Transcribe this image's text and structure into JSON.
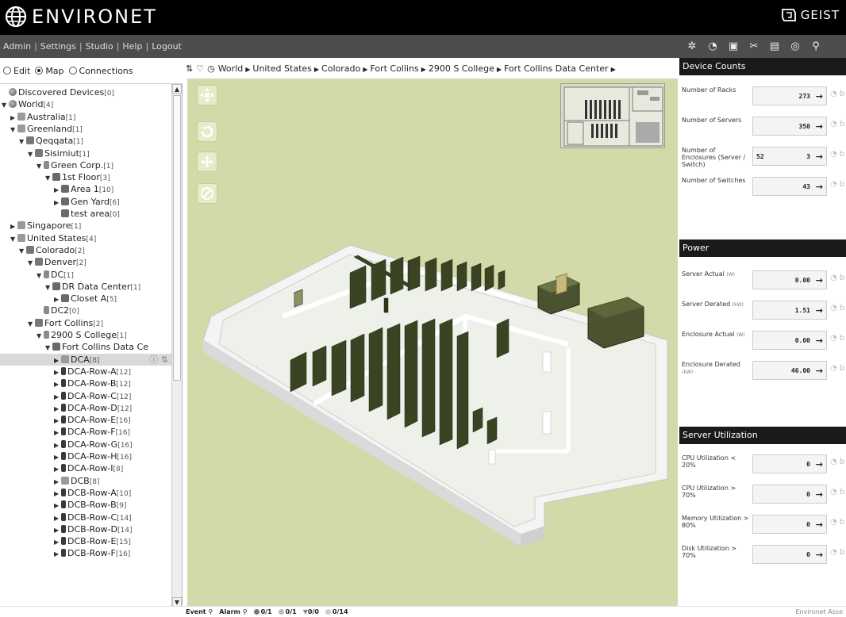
{
  "app": {
    "logo_text": "ENVIRONET",
    "brand": "GEIST"
  },
  "menu": {
    "items": [
      "Admin",
      "Settings",
      "Studio",
      "Help",
      "Logout"
    ]
  },
  "toolbar": {
    "icons": [
      "gear-icon",
      "dashboard-icon",
      "clipboard-icon",
      "scissors-icon",
      "server-icon",
      "globe-search-icon",
      "search-icon"
    ]
  },
  "view_modes": {
    "edit": "Edit",
    "map": "Map",
    "connections": "Connections",
    "selected": "Map"
  },
  "breadcrumb": [
    "World",
    "United States",
    "Colorado",
    "Fort Collins",
    "2900 S College",
    "Fort Collins Data Center"
  ],
  "tree": [
    {
      "label": "Discovered Devices",
      "count": "[0]",
      "icon": "globe",
      "expanded": null,
      "depth": 0
    },
    {
      "label": "World",
      "count": "[4]",
      "icon": "globe",
      "expanded": true,
      "depth": 0
    },
    {
      "label": "Australia",
      "count": "[1]",
      "icon": "flag",
      "expanded": false,
      "depth": 1
    },
    {
      "label": "Greenland",
      "count": "[1]",
      "icon": "flag",
      "expanded": true,
      "depth": 1
    },
    {
      "label": "Qeqqata",
      "count": "[1]",
      "icon": "city",
      "expanded": true,
      "depth": 2
    },
    {
      "label": "Sisimiut",
      "count": "[1]",
      "icon": "city",
      "expanded": true,
      "depth": 3
    },
    {
      "label": "Green Corp.",
      "count": "[1]",
      "icon": "bldg",
      "expanded": true,
      "depth": 4
    },
    {
      "label": "1st Floor",
      "count": "[3]",
      "icon": "floor",
      "expanded": true,
      "depth": 5
    },
    {
      "label": "Area 1",
      "count": "[10]",
      "icon": "floor",
      "expanded": false,
      "depth": 6
    },
    {
      "label": "Gen Yard",
      "count": "[6]",
      "icon": "floor",
      "expanded": false,
      "depth": 6
    },
    {
      "label": "test area",
      "count": "[0]",
      "icon": "floor",
      "expanded": null,
      "depth": 6
    },
    {
      "label": "Singapore",
      "count": "[1]",
      "icon": "flag",
      "expanded": false,
      "depth": 1
    },
    {
      "label": "United States",
      "count": "[4]",
      "icon": "flag",
      "expanded": true,
      "depth": 1
    },
    {
      "label": "Colorado",
      "count": "[2]",
      "icon": "city",
      "expanded": true,
      "depth": 2
    },
    {
      "label": "Denver",
      "count": "[2]",
      "icon": "city",
      "expanded": true,
      "depth": 3
    },
    {
      "label": "DC",
      "count": "[1]",
      "icon": "bldg",
      "expanded": true,
      "depth": 4
    },
    {
      "label": "DR Data Center",
      "count": "[1]",
      "icon": "floor",
      "expanded": true,
      "depth": 5
    },
    {
      "label": "Closet A",
      "count": "[5]",
      "icon": "floor",
      "expanded": false,
      "depth": 6
    },
    {
      "label": "DC2",
      "count": "[0]",
      "icon": "bldg",
      "expanded": null,
      "depth": 4
    },
    {
      "label": "Fort Collins",
      "count": "[2]",
      "icon": "city",
      "expanded": true,
      "depth": 3
    },
    {
      "label": "2900 S College",
      "count": "[1]",
      "icon": "bldg",
      "expanded": true,
      "depth": 4
    },
    {
      "label": "Fort Collins Data Ce",
      "count": "",
      "icon": "floor",
      "expanded": true,
      "depth": 5
    },
    {
      "label": "DCA",
      "count": "[8]",
      "icon": "flag",
      "expanded": false,
      "depth": 6,
      "selected": true
    },
    {
      "label": "DCA-Row-A",
      "count": "[12]",
      "icon": "row",
      "expanded": false,
      "depth": 6
    },
    {
      "label": "DCA-Row-B",
      "count": "[12]",
      "icon": "row",
      "expanded": false,
      "depth": 6
    },
    {
      "label": "DCA-Row-C",
      "count": "[12]",
      "icon": "row",
      "expanded": false,
      "depth": 6
    },
    {
      "label": "DCA-Row-D",
      "count": "[12]",
      "icon": "row",
      "expanded": false,
      "depth": 6
    },
    {
      "label": "DCA-Row-E",
      "count": "[16]",
      "icon": "row",
      "expanded": false,
      "depth": 6
    },
    {
      "label": "DCA-Row-F",
      "count": "[16]",
      "icon": "row",
      "expanded": false,
      "depth": 6
    },
    {
      "label": "DCA-Row-G",
      "count": "[16]",
      "icon": "row",
      "expanded": false,
      "depth": 6
    },
    {
      "label": "DCA-Row-H",
      "count": "[16]",
      "icon": "row",
      "expanded": false,
      "depth": 6
    },
    {
      "label": "DCA-Row-I",
      "count": "[8]",
      "icon": "row",
      "expanded": false,
      "depth": 6
    },
    {
      "label": "DCB",
      "count": "[8]",
      "icon": "flag",
      "expanded": false,
      "depth": 6
    },
    {
      "label": "DCB-Row-A",
      "count": "[10]",
      "icon": "row",
      "expanded": false,
      "depth": 6
    },
    {
      "label": "DCB-Row-B",
      "count": "[9]",
      "icon": "row",
      "expanded": false,
      "depth": 6
    },
    {
      "label": "DCB-Row-C",
      "count": "[14]",
      "icon": "row",
      "expanded": false,
      "depth": 6
    },
    {
      "label": "DCB-Row-D",
      "count": "[14]",
      "icon": "row",
      "expanded": false,
      "depth": 6
    },
    {
      "label": "DCB-Row-E",
      "count": "[15]",
      "icon": "row",
      "expanded": false,
      "depth": 6
    },
    {
      "label": "DCB-Row-F",
      "count": "[16]",
      "icon": "row",
      "expanded": false,
      "depth": 6
    }
  ],
  "panels": {
    "device_counts": {
      "title": "Device Counts",
      "metrics": [
        {
          "label": "Number of Racks",
          "unit": "",
          "value": "273"
        },
        {
          "label": "Number of Servers",
          "unit": "",
          "value": "350"
        },
        {
          "label": "Number of Enclosures (Server / Switch)",
          "unit": "",
          "value_left": "52",
          "value": "3"
        },
        {
          "label": "Number of Switches",
          "unit": "",
          "value": "43"
        }
      ]
    },
    "power": {
      "title": "Power",
      "metrics": [
        {
          "label": "Server Actual",
          "unit": "(W)",
          "value": "0.00"
        },
        {
          "label": "Server Derated",
          "unit": "(kW)",
          "value": "1.51"
        },
        {
          "label": "Enclosure Actual",
          "unit": "(W)",
          "value": "0.00"
        },
        {
          "label": "Enclosure Derated",
          "unit": "(kW)",
          "value": "46.00"
        }
      ]
    },
    "server_utilization": {
      "title": "Server Utilization",
      "metrics": [
        {
          "label": "CPU Utilization < 20%",
          "unit": "",
          "value": "0"
        },
        {
          "label": "CPU Utilization > 70%",
          "unit": "",
          "value": "0"
        },
        {
          "label": "Memory Utilization > 80%",
          "unit": "",
          "value": "0"
        },
        {
          "label": "Disk Utilization > 70%",
          "unit": "",
          "value": "0"
        }
      ]
    }
  },
  "status": {
    "event": "Event",
    "alarm": "Alarm",
    "counts": [
      "0/1",
      "0/1",
      "0/0",
      "0/14"
    ],
    "footer": "Environet Asse"
  }
}
